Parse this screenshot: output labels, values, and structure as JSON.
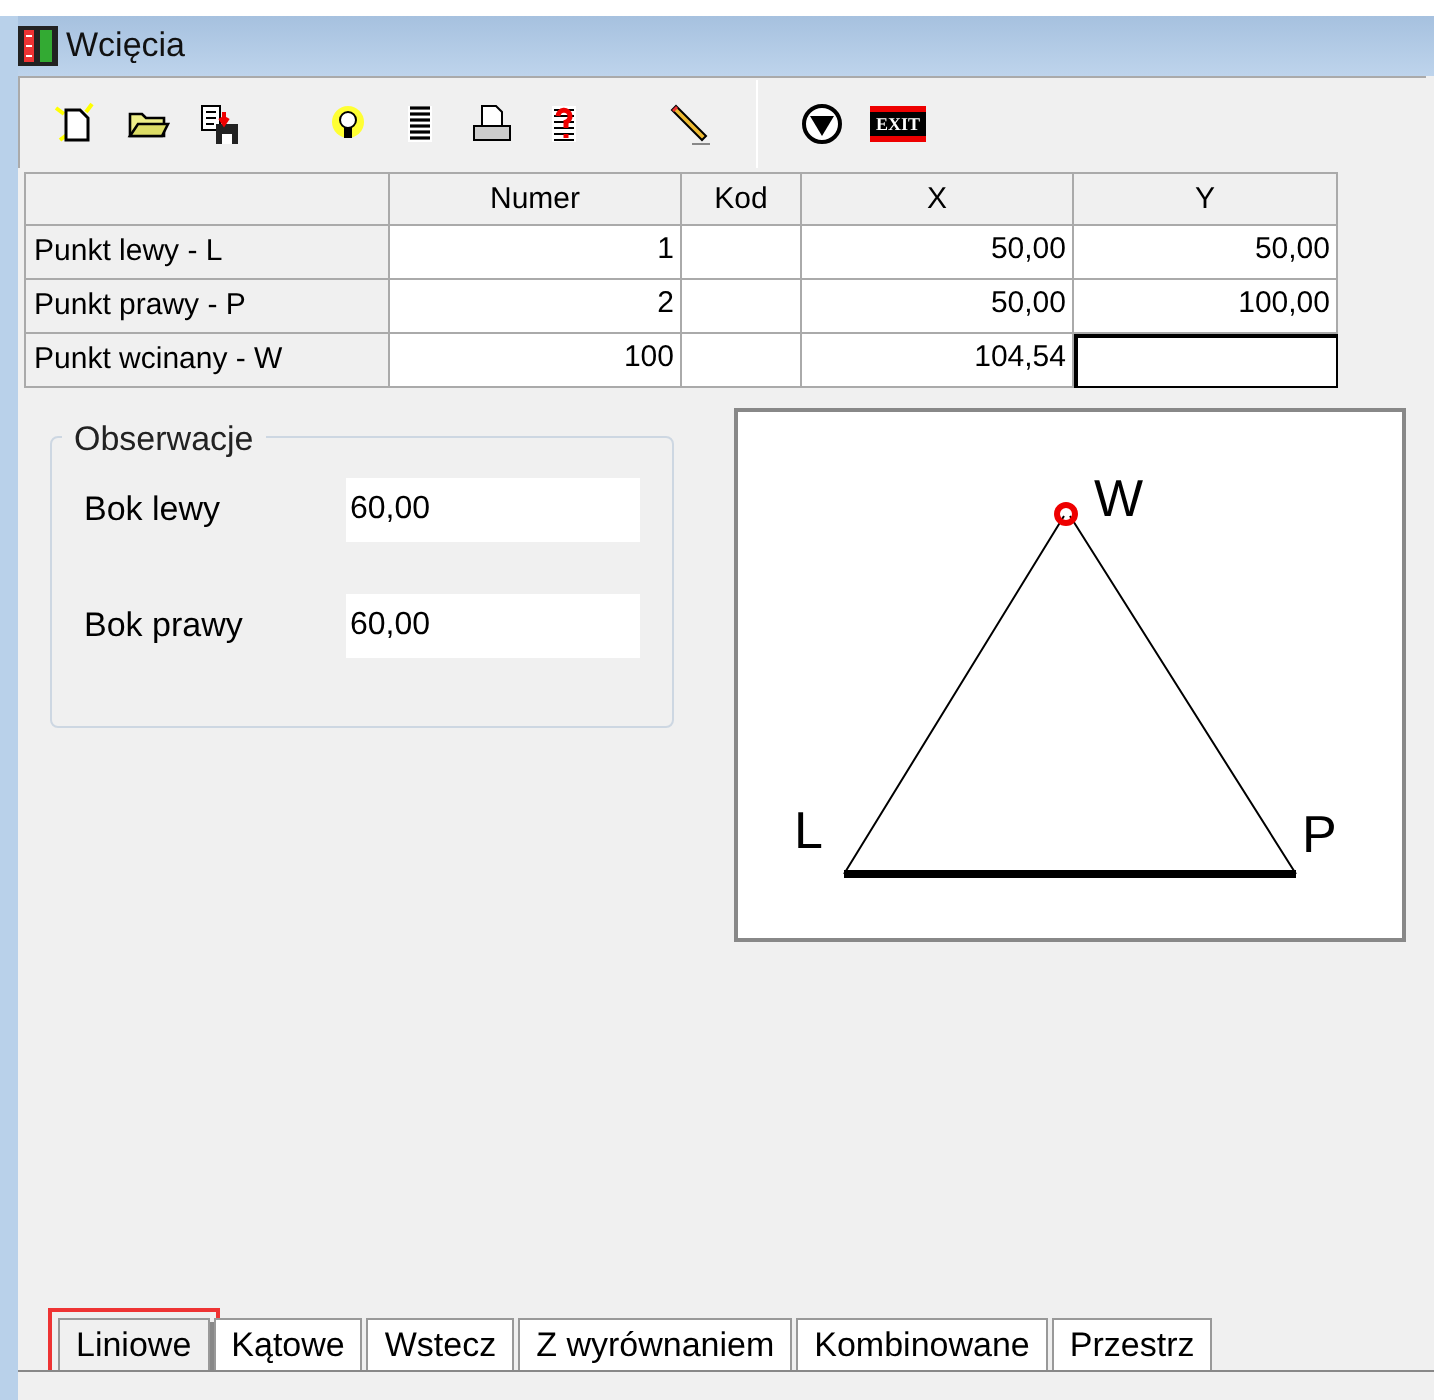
{
  "window": {
    "title": "Wcięcia"
  },
  "toolbar": [
    {
      "kind": "new"
    },
    {
      "kind": "open"
    },
    {
      "kind": "save"
    },
    {
      "kind": "gap"
    },
    {
      "kind": "bulb"
    },
    {
      "kind": "list"
    },
    {
      "kind": "print"
    },
    {
      "kind": "help"
    },
    {
      "kind": "gap"
    },
    {
      "kind": "pencil"
    },
    {
      "kind": "separator"
    },
    {
      "kind": "down"
    },
    {
      "kind": "exit",
      "text": "EXIT"
    }
  ],
  "table": {
    "columns": [
      "Numer",
      "Kod",
      "X",
      "Y"
    ],
    "rows": [
      {
        "label": "Punkt lewy - L",
        "cells": [
          "1",
          "",
          "50,00",
          "50,00"
        ],
        "focused": false
      },
      {
        "label": "Punkt prawy - P",
        "cells": [
          "2",
          "",
          "50,00",
          "100,00"
        ],
        "focused": false
      },
      {
        "label": "Punkt wcinany - W",
        "cells": [
          "100",
          "",
          "104,54",
          ""
        ],
        "focused": true
      }
    ]
  },
  "observations": {
    "title": "Obserwacje",
    "fields": [
      {
        "label": "Bok lewy",
        "value": "60,00"
      },
      {
        "label": "Bok prawy",
        "value": "60,00"
      }
    ]
  },
  "diagram": {
    "top": "W",
    "left": "L",
    "right": "P"
  },
  "tabs": [
    {
      "label": "Liniowe",
      "selected": true,
      "highlighted": true
    },
    {
      "label": "Kątowe",
      "selected": false,
      "highlighted": false
    },
    {
      "label": "Wstecz",
      "selected": false,
      "highlighted": false
    },
    {
      "label": "Z wyrównaniem",
      "selected": false,
      "highlighted": false
    },
    {
      "label": "Kombinowane",
      "selected": false,
      "highlighted": false
    },
    {
      "label": "Przestrz",
      "selected": false,
      "highlighted": false
    }
  ]
}
